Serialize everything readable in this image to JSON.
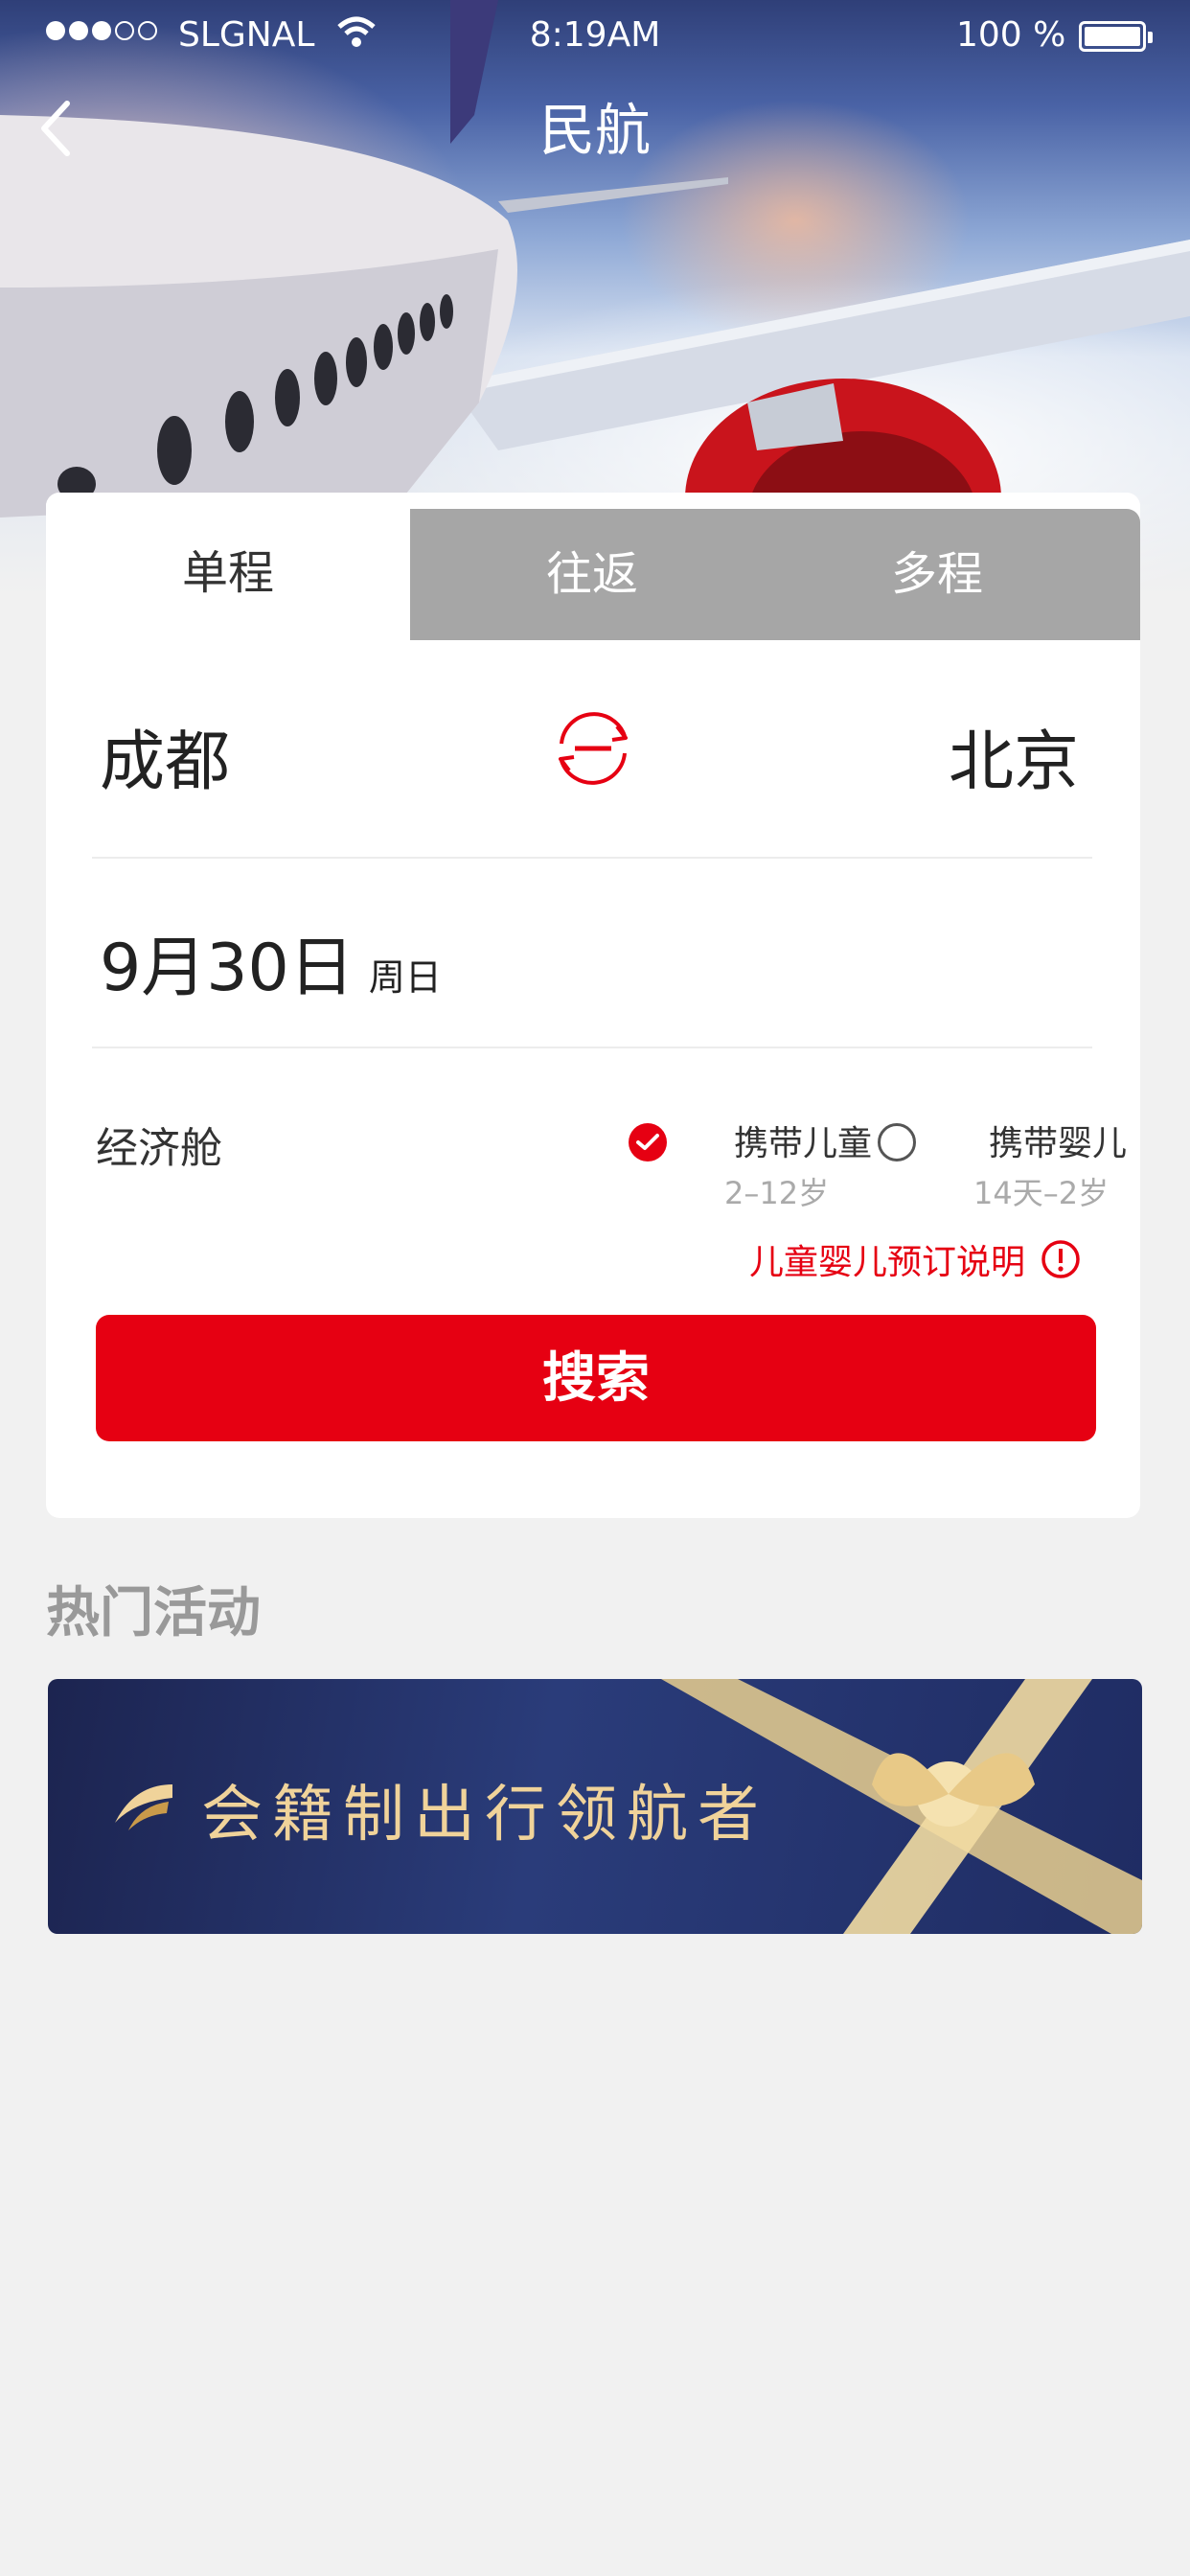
{
  "status_bar": {
    "carrier": "SLGNAL",
    "time": "8:19AM",
    "battery": "100 %"
  },
  "nav": {
    "title": "民航"
  },
  "tabs": [
    {
      "label": "单程",
      "active": true
    },
    {
      "label": "往返",
      "active": false
    },
    {
      "label": "多程",
      "active": false
    }
  ],
  "route": {
    "from": "成都",
    "to": "北京"
  },
  "date": {
    "date": "9月30日",
    "weekday": "周日"
  },
  "cabin": "经济舱",
  "options": {
    "child": {
      "label": "携带儿童",
      "sub": "2–12岁",
      "checked": true
    },
    "infant": {
      "label": "携带婴儿",
      "sub": "14天–2岁",
      "checked": false
    }
  },
  "note": "儿童婴儿预订说明",
  "search_label": "搜索",
  "section_title": "热门活动",
  "banner_text": "会籍制出行领航者",
  "colors": {
    "accent": "#e60012",
    "tab_inactive": "#a6a6a6",
    "background": "#f1f1f1"
  }
}
